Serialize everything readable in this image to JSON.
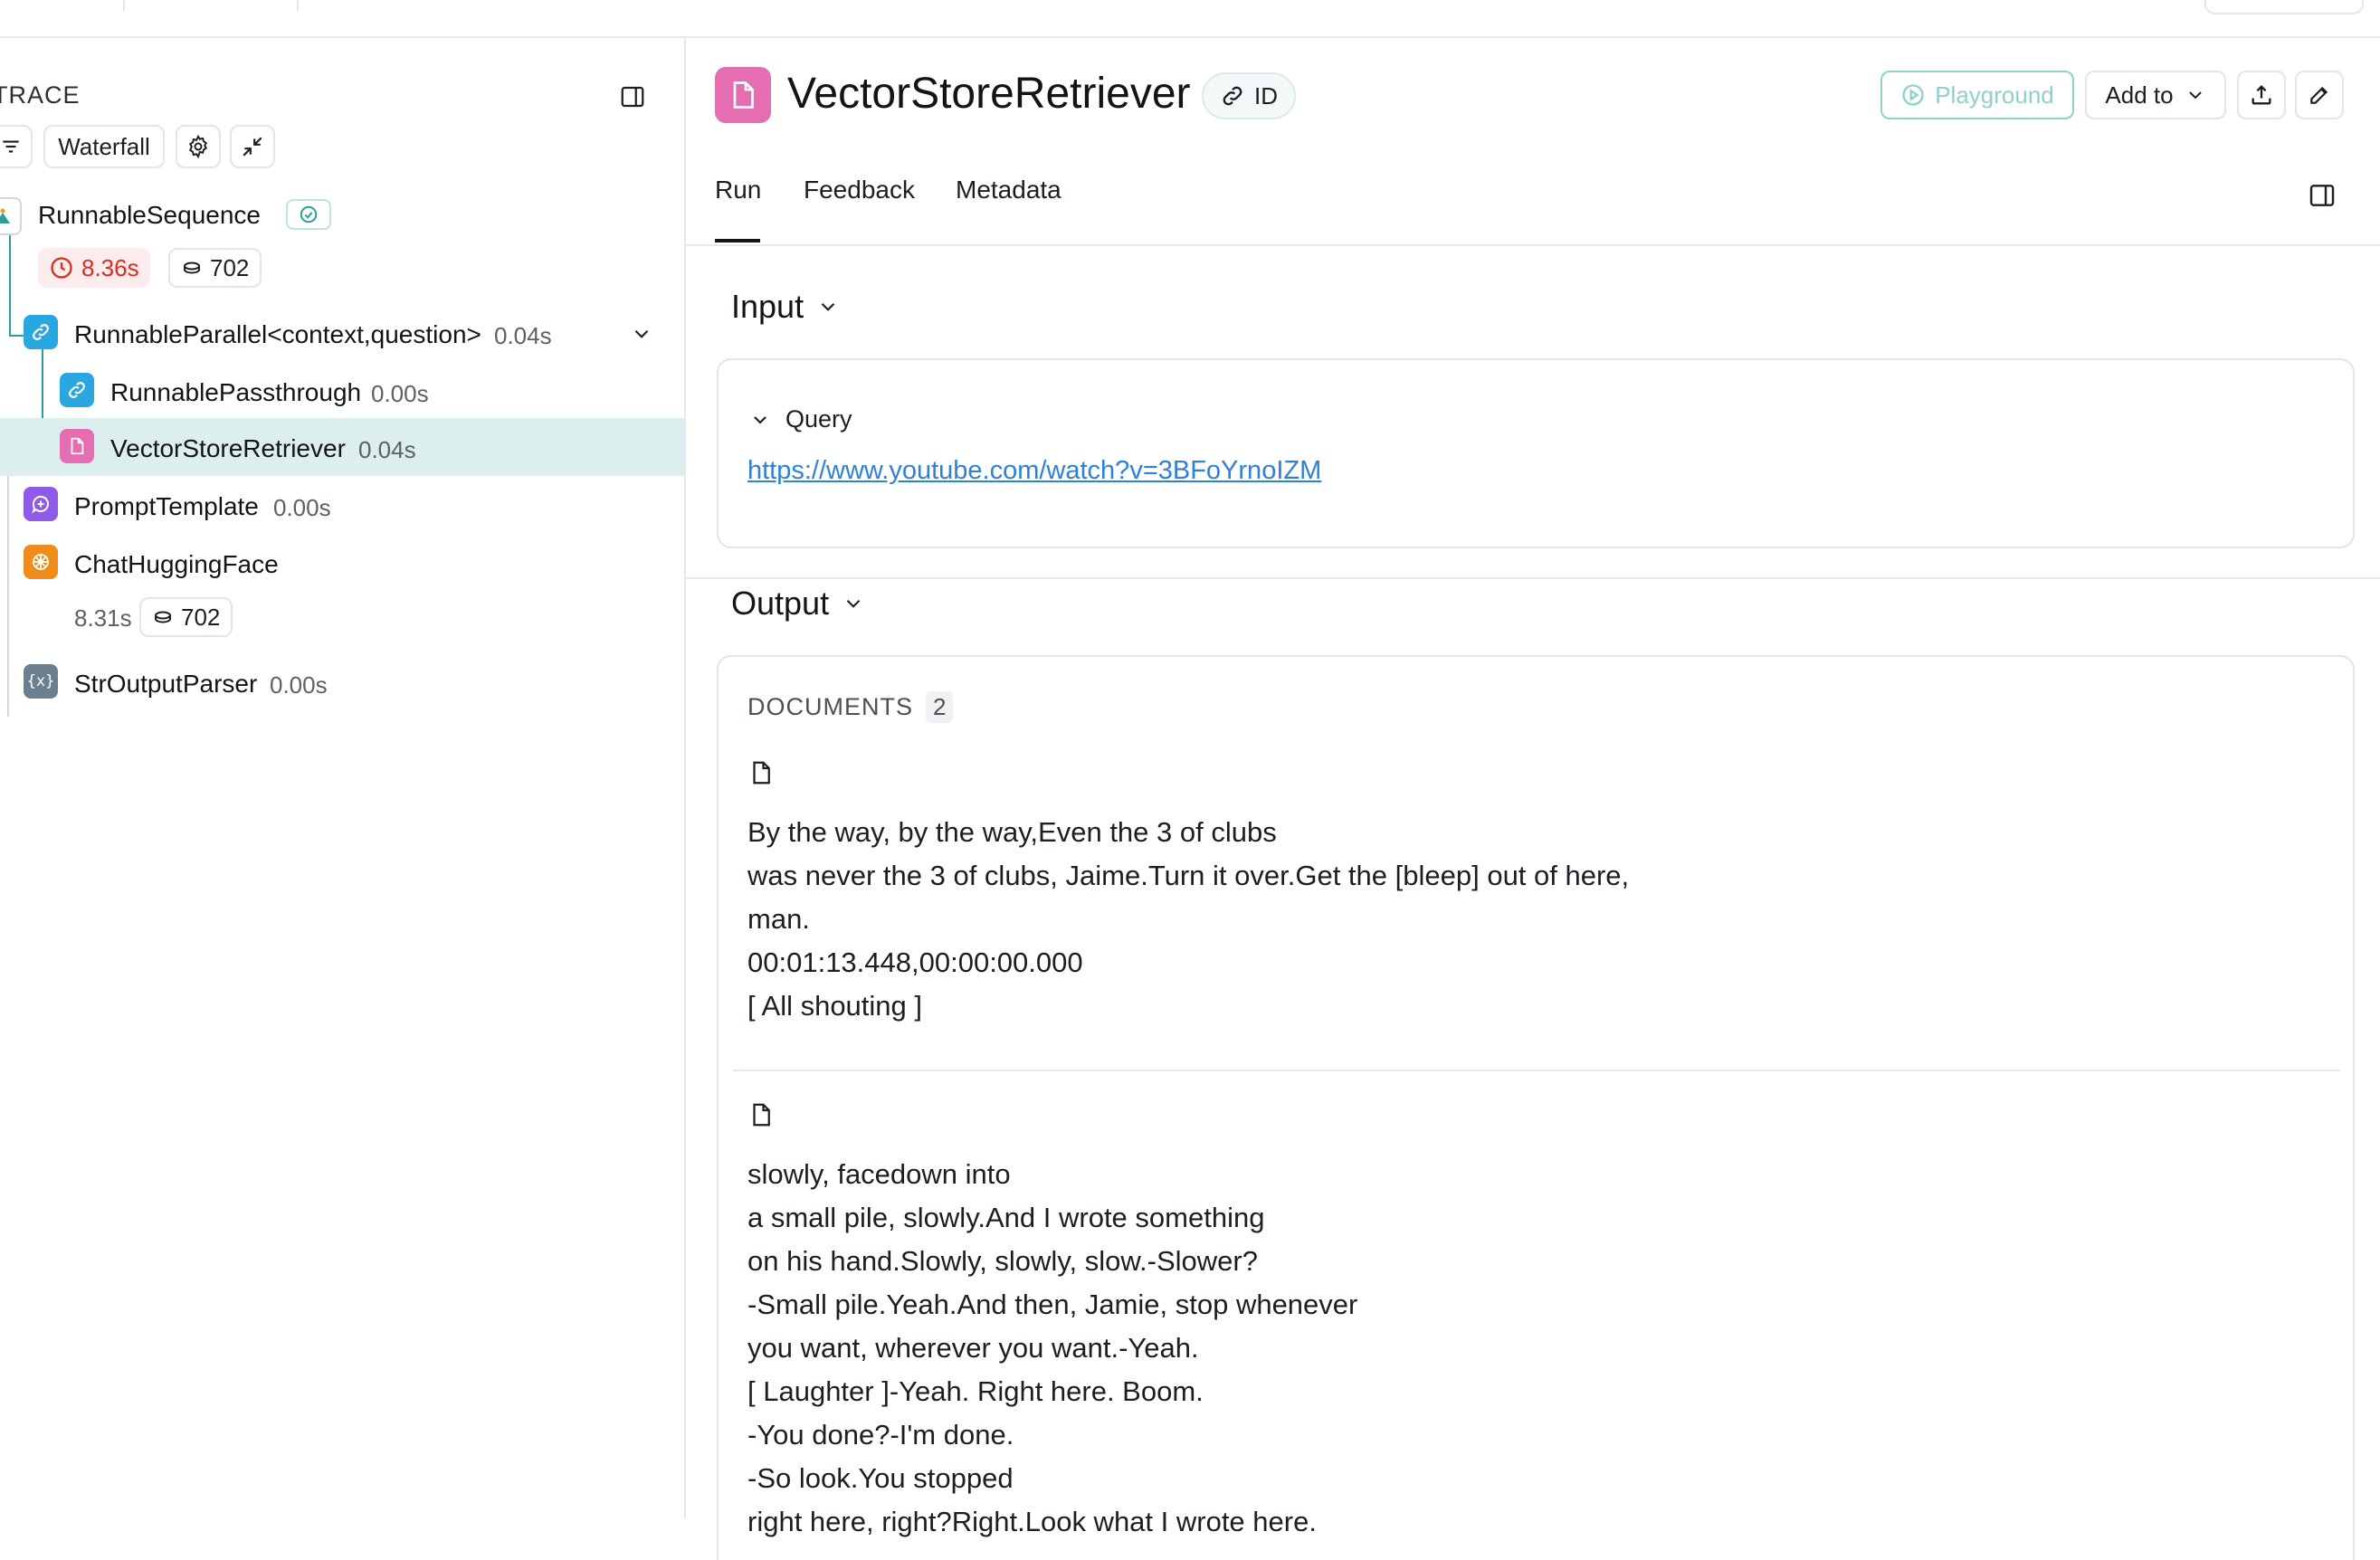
{
  "left_panel": {
    "title": "TRACE",
    "toolbar": {
      "view_mode": "Waterfall"
    },
    "root": {
      "name": "RunnableSequence",
      "latency": "8.36s",
      "tokens": "702"
    },
    "nodes": [
      {
        "name": "RunnableParallel<context,question>",
        "time": "0.04s"
      },
      {
        "name": "RunnablePassthrough",
        "time": "0.00s"
      },
      {
        "name": "VectorStoreRetriever",
        "time": "0.04s"
      },
      {
        "name": "PromptTemplate",
        "time": "0.00s"
      },
      {
        "name": "ChatHuggingFace",
        "time": "8.31s",
        "tokens": "702"
      },
      {
        "name": "StrOutputParser",
        "time": "0.00s"
      }
    ]
  },
  "header": {
    "title": "VectorStoreRetriever",
    "id_label": "ID",
    "playground_label": "Playground",
    "add_to_label": "Add to"
  },
  "tabs": [
    "Run",
    "Feedback",
    "Metadata"
  ],
  "input": {
    "title": "Input",
    "query_label": "Query",
    "query_value": "https://www.youtube.com/watch?v=3BFoYrnoIZM"
  },
  "output": {
    "title": "Output",
    "documents_label": "DOCUMENTS",
    "documents_count": "2",
    "documents": [
      {
        "lines": [
          "By the way, by the way,Even the 3 of clubs",
          "was never the 3 of clubs, Jaime.Turn it over.Get the [bleep] out of here,",
          "man.",
          "00:01:13.448,00:00:00.000",
          "[ All shouting ]"
        ]
      },
      {
        "lines": [
          "slowly, facedown into",
          "a small pile, slowly.And I wrote something",
          "on his hand.Slowly, slowly, slow.-Slower?",
          "-Small pile.Yeah.And then, Jamie, stop whenever",
          "you want, wherever you want.-Yeah.",
          "[ Laughter ]-Yeah. Right here. Boom.",
          "-You done?-I'm done.",
          "-So look.You stopped",
          "right here, right?Right.Look what I wrote here."
        ]
      }
    ]
  },
  "colors": {
    "accent_teal": "#2b9e97",
    "retriever_pink": "#e56db1",
    "link_blue": "#2f80d8",
    "error_red": "#d92d20",
    "selected_row": "#dcefee"
  }
}
